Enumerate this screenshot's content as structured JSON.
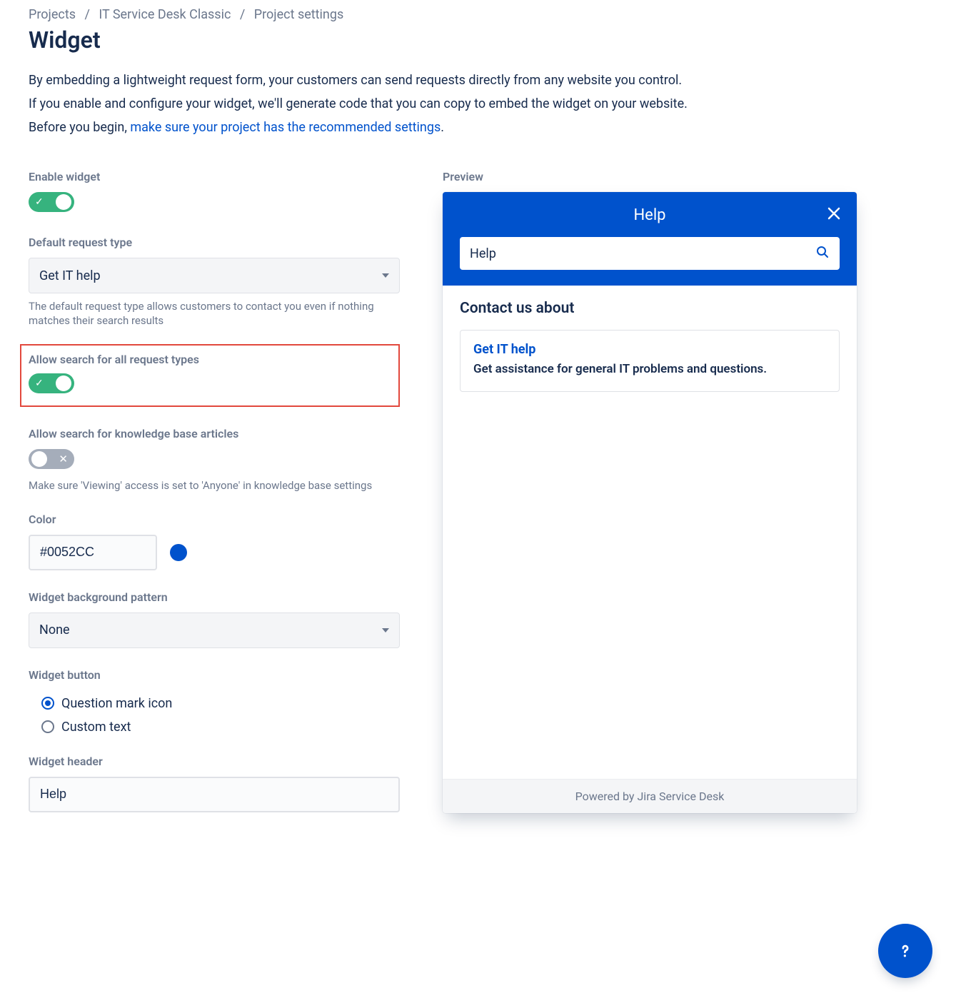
{
  "breadcrumb": {
    "a": "Projects",
    "b": "IT Service Desk Classic",
    "c": "Project settings"
  },
  "page": {
    "title": "Widget",
    "desc1": "By embedding a lightweight request form, your customers can send requests directly from any website you control.",
    "desc2": "If you enable and configure your widget, we'll generate code that you can copy to embed the widget on your website.",
    "desc3_prefix": "Before you begin, ",
    "desc3_link": "make sure your project has the recommended settings",
    "desc3_suffix": "."
  },
  "labels": {
    "enable_widget": "Enable widget",
    "default_request_type": "Default request type",
    "default_request_helper": "The default request type allows customers to contact you even if nothing matches their search results",
    "allow_search_request_types": "Allow search for all request types",
    "allow_search_kb": "Allow search for knowledge base articles",
    "kb_helper": "Make sure 'Viewing' access is set to 'Anyone' in knowledge base settings",
    "color": "Color",
    "bg_pattern": "Widget background pattern",
    "widget_button": "Widget button",
    "widget_header": "Widget header",
    "preview": "Preview"
  },
  "values": {
    "default_request_type": "Get IT help",
    "color": "#0052CC",
    "bg_pattern": "None",
    "button_option_icon": "Question mark icon",
    "button_option_custom": "Custom text",
    "header_text": "Help"
  },
  "preview": {
    "title": "Help",
    "search_value": "Help",
    "contact_heading": "Contact us about",
    "card_title": "Get IT help",
    "card_desc": "Get assistance for general IT problems and questions.",
    "footer": "Powered by Jira Service Desk"
  }
}
